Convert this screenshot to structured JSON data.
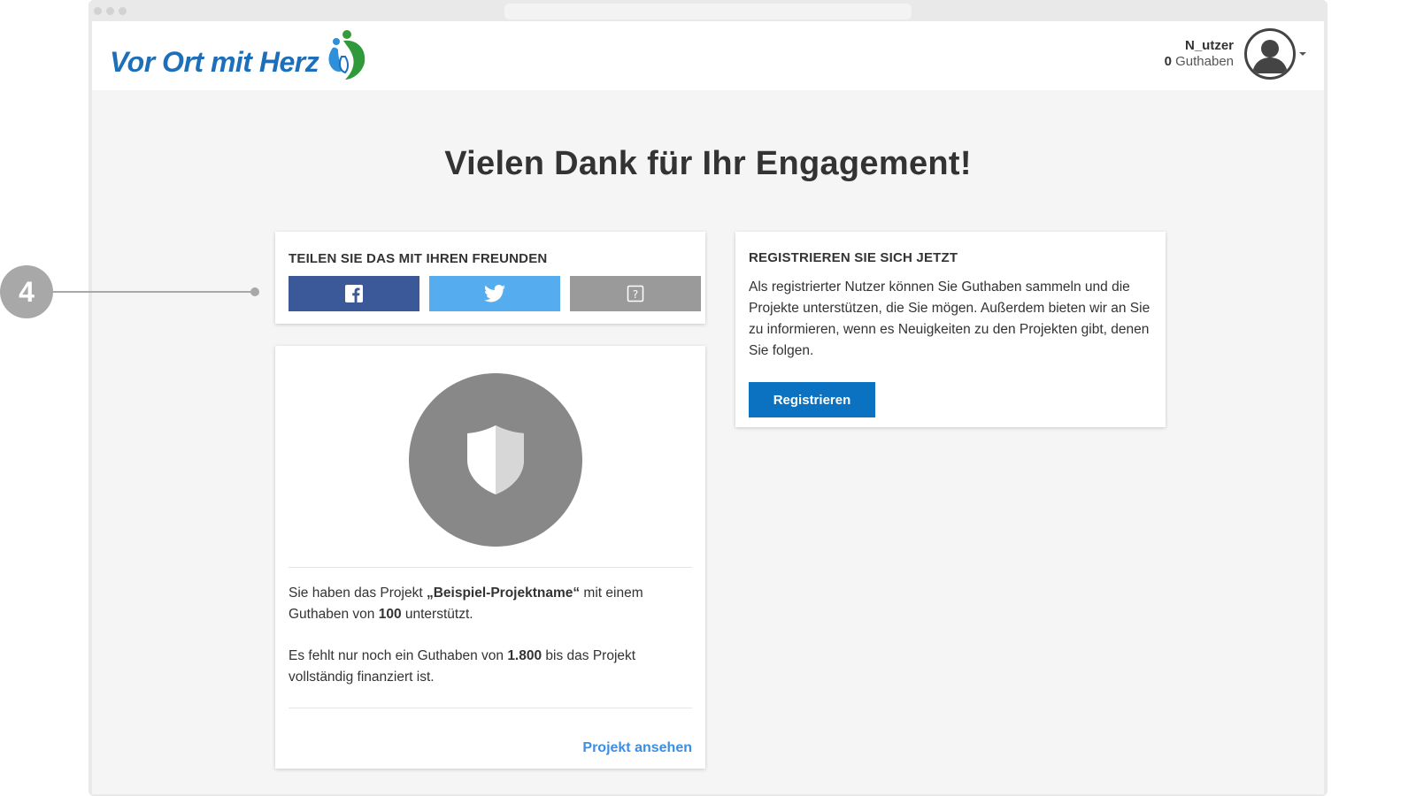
{
  "header": {
    "logo_text": "Vor Ort mit Herz",
    "user_name": "N_utzer",
    "credit_amount": "0",
    "credit_label": "Guthaben"
  },
  "page": {
    "headline": "Vielen Dank für Ihr Engagement!"
  },
  "share": {
    "title": "TEILEN SIE DAS MIT IHREN FREUNDEN",
    "buttons": [
      {
        "name": "facebook",
        "icon": "facebook-icon",
        "color": "#3b5998"
      },
      {
        "name": "twitter",
        "icon": "twitter-icon",
        "color": "#55acee"
      },
      {
        "name": "other",
        "icon": "question-icon",
        "color": "#9a9a9a"
      }
    ]
  },
  "project": {
    "icon": "shield-icon",
    "sentence1_pre": "Sie haben das Projekt ",
    "project_name": "„Beispiel-Projektname“",
    "sentence1_mid": " mit einem Guthaben von ",
    "amount_supported": "100",
    "sentence1_post": " unterstützt.",
    "sentence2_pre": "Es fehlt nur noch ein Guthaben von ",
    "amount_missing": "1.800",
    "sentence2_post": " bis das Projekt vollständig finanziert ist.",
    "link_label": "Projekt ansehen"
  },
  "register": {
    "title": "REGISTRIEREN SIE SICH JETZT",
    "text": "Als registrierter Nutzer können Sie Guthaben sammeln und die Projekte unterstützen, die Sie mögen. Außerdem bieten wir an Sie zu informieren, wenn es Neuigkeiten zu den Projekten gibt, denen Sie folgen.",
    "button_label": "Registrieren"
  },
  "annotation": {
    "number": "4"
  },
  "colors": {
    "brand_blue": "#1c6fb8",
    "button_blue": "#0a72c1",
    "link_blue": "#3a8ee6"
  }
}
